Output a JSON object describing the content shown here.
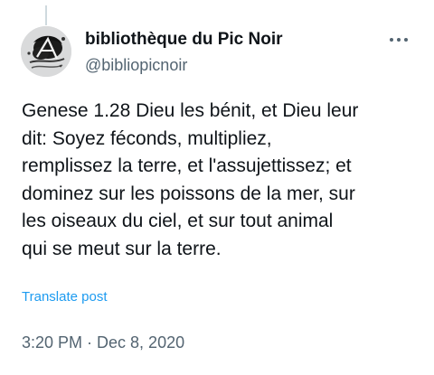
{
  "author": {
    "display_name": "bibliothèque du Pic Noir",
    "handle": "@bibliopicnoir",
    "avatar_icon": "ink-splatter-logo-icon"
  },
  "tweet": {
    "text_lines": [
      "Genese 1.28 Dieu les bénit, et Dieu leur",
      "dit: Soyez féconds, multipliez,",
      "remplissez la terre, et l'assujettissez; et",
      "dominez sur les poissons de la mer, sur",
      "les oiseaux du ciel, et sur tout animal",
      "qui se meut sur la terre."
    ],
    "translate_label": "Translate post",
    "timestamp": "3:20 PM · Dec 8, 2020"
  },
  "colors": {
    "text_primary": "#0f1419",
    "text_secondary": "#536471",
    "link": "#1d9bf0",
    "background": "#ffffff"
  },
  "icons": {
    "more": "more-options-icon"
  }
}
